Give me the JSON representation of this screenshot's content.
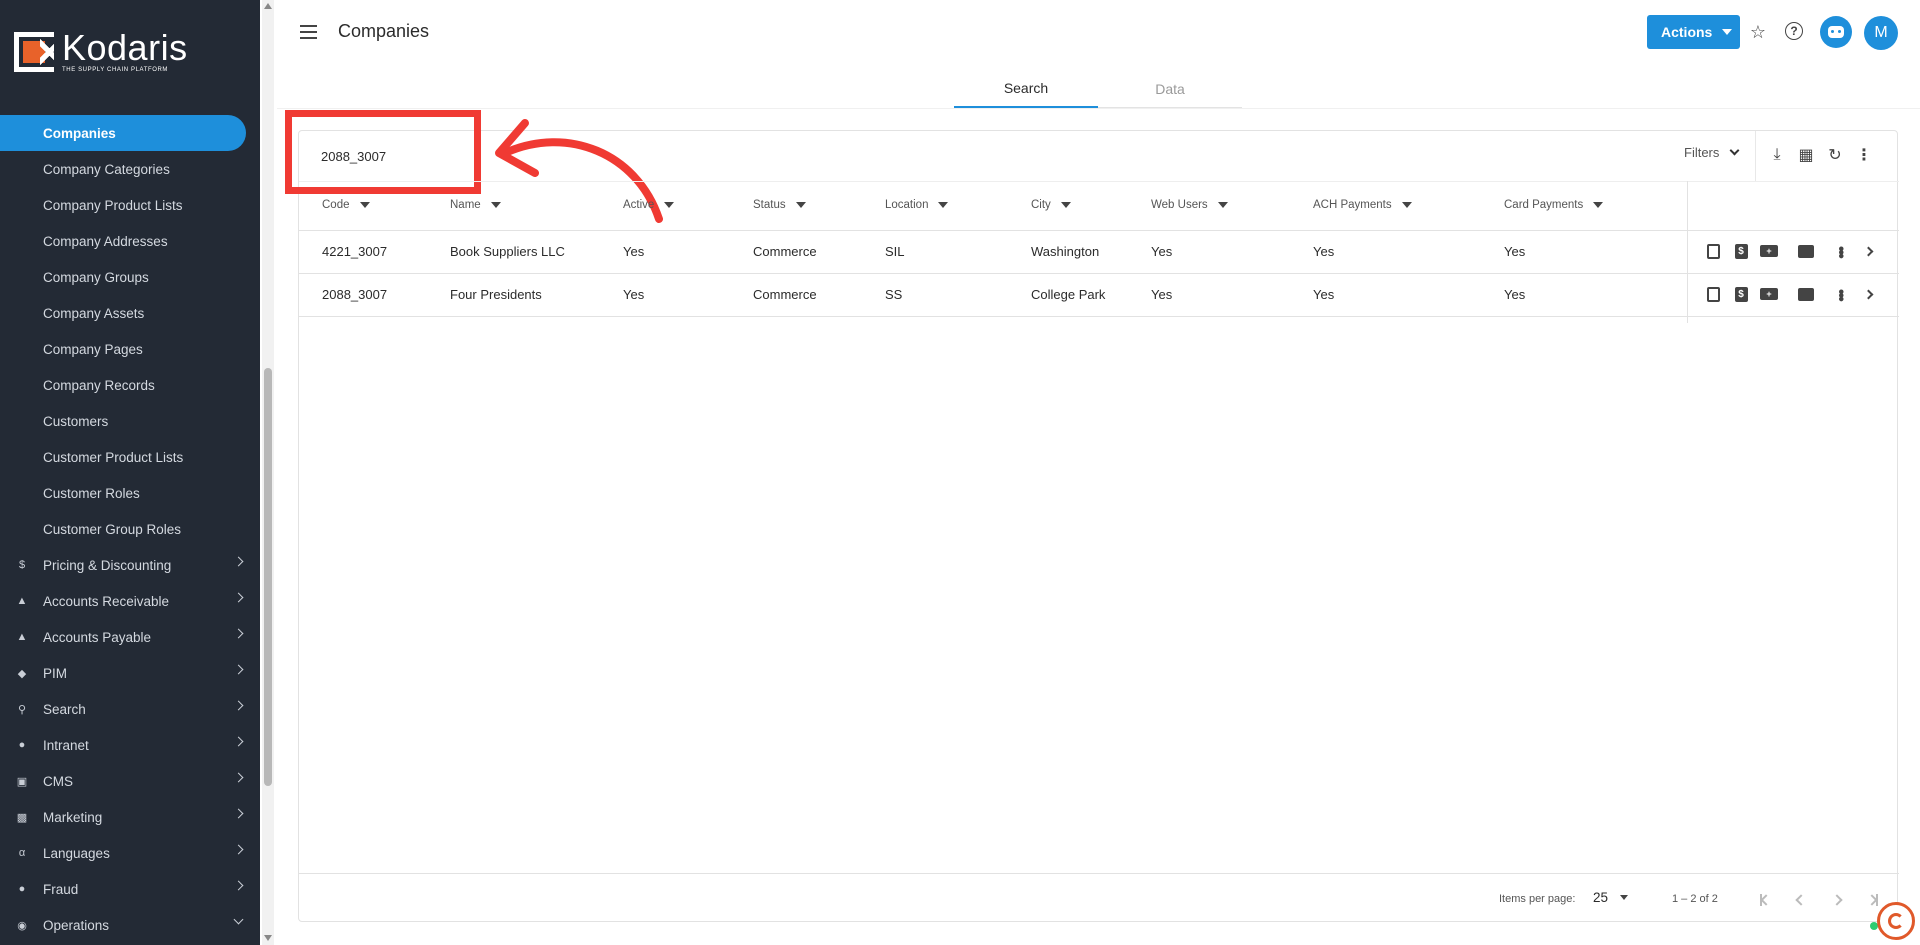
{
  "brand": {
    "name": "Kodaris",
    "tagline": "THE SUPPLY CHAIN PLATFORM",
    "accent": "#1e8fdb",
    "logo_orange": "#e8622a"
  },
  "sidebar": {
    "sub_items": [
      {
        "label": "Companies",
        "active": true
      },
      {
        "label": "Company Categories"
      },
      {
        "label": "Company Product Lists"
      },
      {
        "label": "Company Addresses"
      },
      {
        "label": "Company Groups"
      },
      {
        "label": "Company Assets"
      },
      {
        "label": "Company Pages"
      },
      {
        "label": "Company Records"
      },
      {
        "label": "Customers"
      },
      {
        "label": "Customer Product Lists"
      },
      {
        "label": "Customer Roles"
      },
      {
        "label": "Customer Group Roles"
      }
    ],
    "groups": [
      {
        "label": "Pricing & Discounting",
        "icon": "dollar-icon"
      },
      {
        "label": "Accounts Receivable",
        "icon": "bank-icon"
      },
      {
        "label": "Accounts Payable",
        "icon": "bank-icon"
      },
      {
        "label": "PIM",
        "icon": "tag-icon"
      },
      {
        "label": "Search",
        "icon": "search-icon"
      },
      {
        "label": "Intranet",
        "icon": "globe-icon"
      },
      {
        "label": "CMS",
        "icon": "web-icon"
      },
      {
        "label": "Marketing",
        "icon": "contact-card-icon"
      },
      {
        "label": "Languages",
        "icon": "translate-icon"
      },
      {
        "label": "Fraud",
        "icon": "alert-icon"
      },
      {
        "label": "Operations",
        "icon": "operations-icon",
        "expanded": true
      }
    ]
  },
  "header": {
    "title": "Companies",
    "actions_label": "Actions",
    "avatar_initial": "M"
  },
  "tabs": [
    {
      "label": "Search",
      "active": true
    },
    {
      "label": "Data",
      "active": false
    }
  ],
  "search": {
    "value": "2088_3007"
  },
  "toolbar": {
    "filters_label": "Filters"
  },
  "table": {
    "columns": [
      "Code",
      "Name",
      "Active",
      "Status",
      "Location",
      "City",
      "Web Users",
      "ACH Payments",
      "Card Payments"
    ],
    "rows": [
      [
        "4221_3007",
        "Book Suppliers LLC",
        "Yes",
        "Commerce",
        "SIL",
        "Washington",
        "Yes",
        "Yes",
        "Yes"
      ],
      [
        "2088_3007",
        "Four Presidents",
        "Yes",
        "Commerce",
        "SS",
        "College Park",
        "Yes",
        "Yes",
        "Yes"
      ]
    ]
  },
  "paginator": {
    "items_per_page_label": "Items per page:",
    "items_per_page": "25",
    "range_label": "1 – 2 of 2"
  },
  "annotation": {
    "highlight_color": "#f03a33"
  }
}
